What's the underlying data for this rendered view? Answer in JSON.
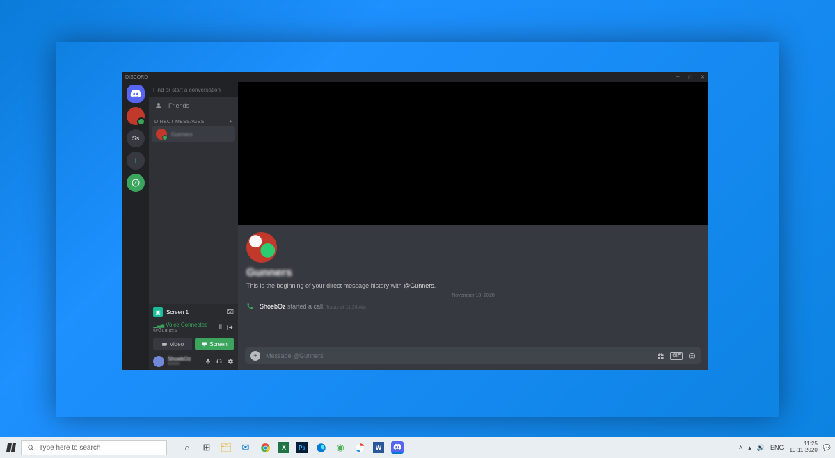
{
  "window": {
    "title": "DISCORD"
  },
  "sidebar": {
    "search_placeholder": "Find or start a conversation",
    "friends_label": "Friends",
    "dm_header": "DIRECT MESSAGES",
    "dm_items": [
      {
        "name": "Gunners"
      }
    ],
    "servers": {
      "ss_label": "Ss"
    }
  },
  "stream": {
    "label": "Screen 1"
  },
  "voice": {
    "status": "Voice Connected",
    "channel": "@Gunners"
  },
  "buttons": {
    "video": "Video",
    "screen": "Screen",
    "plus": "+"
  },
  "user_panel": {
    "name": "ShoebOz",
    "tag": "#0000"
  },
  "chat": {
    "contact_name": "Gunners",
    "intro_prefix": "This is the beginning of your direct message history with ",
    "intro_mention": "@Gunners",
    "intro_suffix": ".",
    "date_divider": "November 10, 2020",
    "call_msg": {
      "user": "ShoebOz",
      "text": " started a call.",
      "time": " Today at 11:24 AM"
    },
    "composer_placeholder": "Message @Gunners",
    "gif_label": "GIF"
  },
  "taskbar": {
    "search_placeholder": "Type here to search",
    "lang": "ENG",
    "time": "11:25",
    "date": "10-11-2020"
  }
}
